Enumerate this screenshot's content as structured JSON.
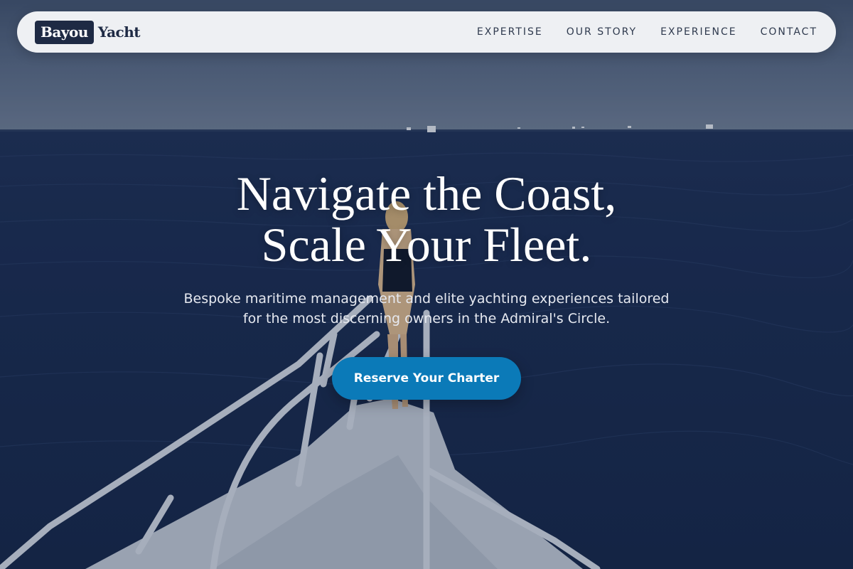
{
  "brand": {
    "logo_box_text": "Bayou",
    "logo_word_text": "Yacht"
  },
  "nav": {
    "items": [
      {
        "label": "EXPERTISE"
      },
      {
        "label": "OUR STORY"
      },
      {
        "label": "EXPERIENCE"
      },
      {
        "label": "CONTACT"
      }
    ]
  },
  "hero": {
    "headline_line1": "Navigate the Coast,",
    "headline_line2": "Scale Your Fleet.",
    "subtitle": "Bespoke maritime management and elite yachting experiences tailored for the most discerning owners in the Admiral's Circle.",
    "cta_label": "Reserve Your Charter",
    "background_image": "yacht-bow-ocean-photo"
  },
  "colors": {
    "nav_background": "#eef0f3",
    "brand_navy": "#1e2a44",
    "cta_blue": "#0b7ab8",
    "headline": "#ffffff"
  }
}
